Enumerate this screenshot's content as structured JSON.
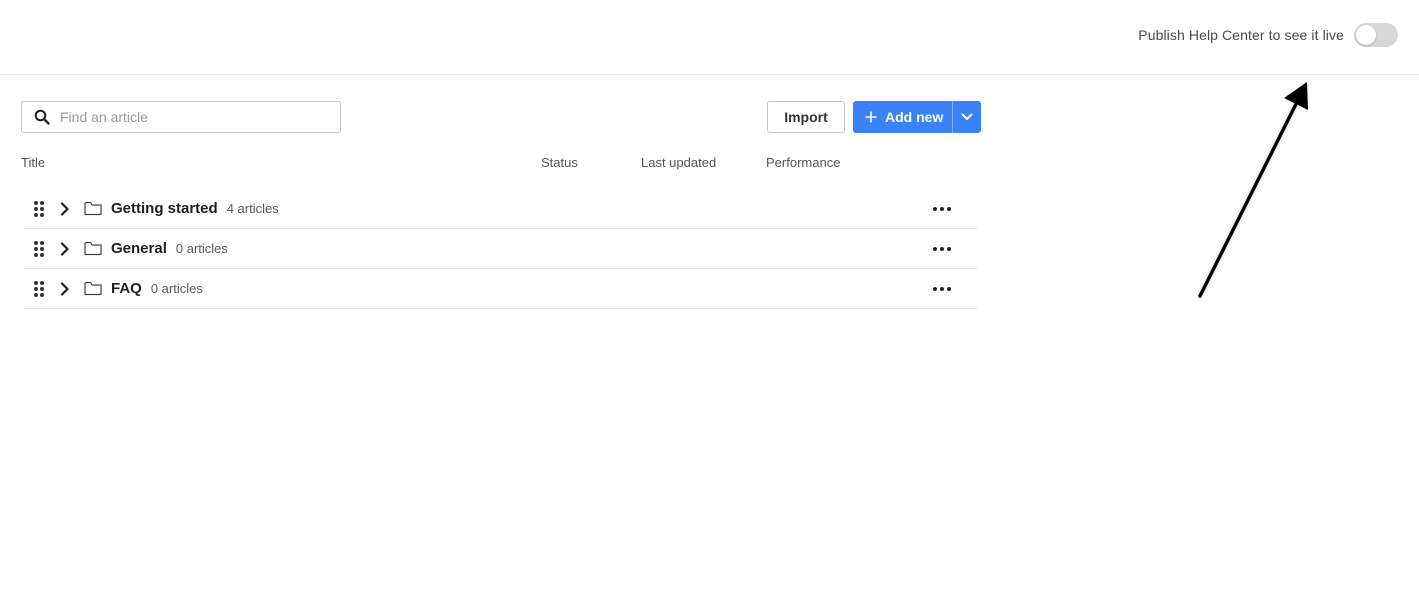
{
  "header": {
    "publish_label": "Publish Help Center to see it live",
    "publish_enabled": false
  },
  "search": {
    "placeholder": "Find an article",
    "value": ""
  },
  "toolbar": {
    "import_label": "Import",
    "add_new_label": "Add new"
  },
  "table": {
    "columns": {
      "title": "Title",
      "status": "Status",
      "last_updated": "Last updated",
      "performance": "Performance"
    },
    "rows": [
      {
        "title": "Getting started",
        "count": "4 articles"
      },
      {
        "title": "General",
        "count": "0 articles"
      },
      {
        "title": "FAQ",
        "count": "0 articles"
      }
    ]
  },
  "colors": {
    "accent": "#3b82f6",
    "toggle_off": "#d8d8d8"
  }
}
